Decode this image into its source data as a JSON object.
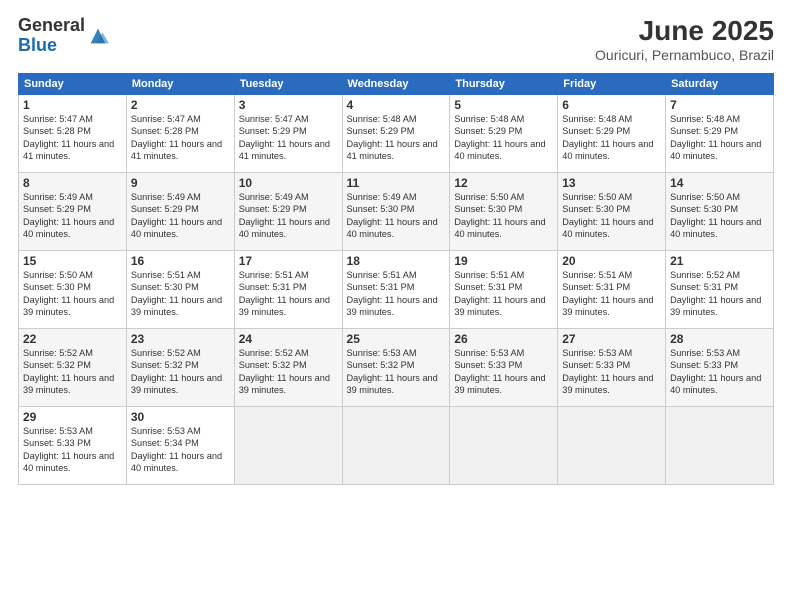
{
  "logo": {
    "general": "General",
    "blue": "Blue"
  },
  "title": "June 2025",
  "subtitle": "Ouricuri, Pernambuco, Brazil",
  "days_header": [
    "Sunday",
    "Monday",
    "Tuesday",
    "Wednesday",
    "Thursday",
    "Friday",
    "Saturday"
  ],
  "weeks": [
    [
      {
        "day": "1",
        "sunrise": "5:47 AM",
        "sunset": "5:28 PM",
        "daylight": "11 hours and 41 minutes."
      },
      {
        "day": "2",
        "sunrise": "5:47 AM",
        "sunset": "5:28 PM",
        "daylight": "11 hours and 41 minutes."
      },
      {
        "day": "3",
        "sunrise": "5:47 AM",
        "sunset": "5:29 PM",
        "daylight": "11 hours and 41 minutes."
      },
      {
        "day": "4",
        "sunrise": "5:48 AM",
        "sunset": "5:29 PM",
        "daylight": "11 hours and 41 minutes."
      },
      {
        "day": "5",
        "sunrise": "5:48 AM",
        "sunset": "5:29 PM",
        "daylight": "11 hours and 40 minutes."
      },
      {
        "day": "6",
        "sunrise": "5:48 AM",
        "sunset": "5:29 PM",
        "daylight": "11 hours and 40 minutes."
      },
      {
        "day": "7",
        "sunrise": "5:48 AM",
        "sunset": "5:29 PM",
        "daylight": "11 hours and 40 minutes."
      }
    ],
    [
      {
        "day": "8",
        "sunrise": "5:49 AM",
        "sunset": "5:29 PM",
        "daylight": "11 hours and 40 minutes."
      },
      {
        "day": "9",
        "sunrise": "5:49 AM",
        "sunset": "5:29 PM",
        "daylight": "11 hours and 40 minutes."
      },
      {
        "day": "10",
        "sunrise": "5:49 AM",
        "sunset": "5:29 PM",
        "daylight": "11 hours and 40 minutes."
      },
      {
        "day": "11",
        "sunrise": "5:49 AM",
        "sunset": "5:30 PM",
        "daylight": "11 hours and 40 minutes."
      },
      {
        "day": "12",
        "sunrise": "5:50 AM",
        "sunset": "5:30 PM",
        "daylight": "11 hours and 40 minutes."
      },
      {
        "day": "13",
        "sunrise": "5:50 AM",
        "sunset": "5:30 PM",
        "daylight": "11 hours and 40 minutes."
      },
      {
        "day": "14",
        "sunrise": "5:50 AM",
        "sunset": "5:30 PM",
        "daylight": "11 hours and 40 minutes."
      }
    ],
    [
      {
        "day": "15",
        "sunrise": "5:50 AM",
        "sunset": "5:30 PM",
        "daylight": "11 hours and 39 minutes."
      },
      {
        "day": "16",
        "sunrise": "5:51 AM",
        "sunset": "5:30 PM",
        "daylight": "11 hours and 39 minutes."
      },
      {
        "day": "17",
        "sunrise": "5:51 AM",
        "sunset": "5:31 PM",
        "daylight": "11 hours and 39 minutes."
      },
      {
        "day": "18",
        "sunrise": "5:51 AM",
        "sunset": "5:31 PM",
        "daylight": "11 hours and 39 minutes."
      },
      {
        "day": "19",
        "sunrise": "5:51 AM",
        "sunset": "5:31 PM",
        "daylight": "11 hours and 39 minutes."
      },
      {
        "day": "20",
        "sunrise": "5:51 AM",
        "sunset": "5:31 PM",
        "daylight": "11 hours and 39 minutes."
      },
      {
        "day": "21",
        "sunrise": "5:52 AM",
        "sunset": "5:31 PM",
        "daylight": "11 hours and 39 minutes."
      }
    ],
    [
      {
        "day": "22",
        "sunrise": "5:52 AM",
        "sunset": "5:32 PM",
        "daylight": "11 hours and 39 minutes."
      },
      {
        "day": "23",
        "sunrise": "5:52 AM",
        "sunset": "5:32 PM",
        "daylight": "11 hours and 39 minutes."
      },
      {
        "day": "24",
        "sunrise": "5:52 AM",
        "sunset": "5:32 PM",
        "daylight": "11 hours and 39 minutes."
      },
      {
        "day": "25",
        "sunrise": "5:53 AM",
        "sunset": "5:32 PM",
        "daylight": "11 hours and 39 minutes."
      },
      {
        "day": "26",
        "sunrise": "5:53 AM",
        "sunset": "5:33 PM",
        "daylight": "11 hours and 39 minutes."
      },
      {
        "day": "27",
        "sunrise": "5:53 AM",
        "sunset": "5:33 PM",
        "daylight": "11 hours and 39 minutes."
      },
      {
        "day": "28",
        "sunrise": "5:53 AM",
        "sunset": "5:33 PM",
        "daylight": "11 hours and 40 minutes."
      }
    ],
    [
      {
        "day": "29",
        "sunrise": "5:53 AM",
        "sunset": "5:33 PM",
        "daylight": "11 hours and 40 minutes."
      },
      {
        "day": "30",
        "sunrise": "5:53 AM",
        "sunset": "5:34 PM",
        "daylight": "11 hours and 40 minutes."
      },
      null,
      null,
      null,
      null,
      null
    ]
  ]
}
